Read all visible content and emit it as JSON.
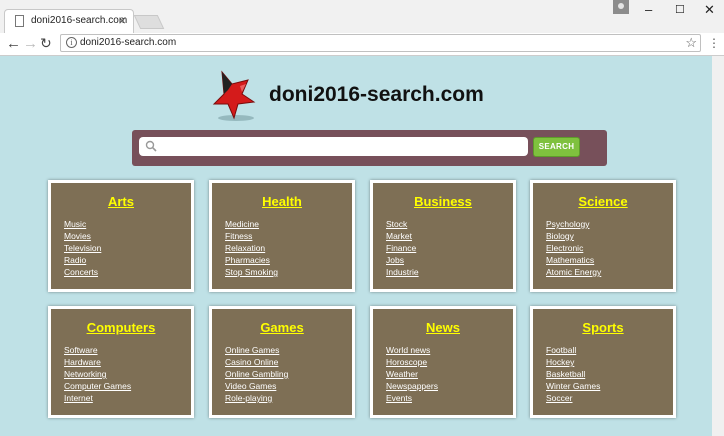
{
  "browser": {
    "tab_title": "doni2016-search.com",
    "address": "doni2016-search.com",
    "icons": [
      "document-icon",
      "close-icon",
      "user-icon",
      "minimize-icon",
      "maximize-icon",
      "close-window-icon",
      "back-icon",
      "forward-icon",
      "reload-icon",
      "info-icon",
      "bookmark-star-icon",
      "menu-icon"
    ]
  },
  "header": {
    "site_title": "doni2016-search.com",
    "logo_icon": "red-star-icon"
  },
  "search": {
    "placeholder": "",
    "button_label": "SEARCH",
    "accent": "#7fc13e",
    "bar_color": "#77505a"
  },
  "categories": [
    {
      "title": "Arts",
      "links": [
        "Music",
        "Movies",
        "Television",
        "Radio",
        "Concerts"
      ]
    },
    {
      "title": "Health",
      "links": [
        "Medicine",
        "Fitness",
        "Relaxation",
        "Pharmacies",
        "Stop Smoking"
      ]
    },
    {
      "title": "Business",
      "links": [
        "Stock",
        "Market",
        "Finance",
        "Jobs",
        "Industrie"
      ]
    },
    {
      "title": "Science",
      "links": [
        "Psychology",
        "Biology",
        "Electronic",
        "Mathematics",
        "Atomic Energy"
      ]
    },
    {
      "title": "Computers",
      "links": [
        "Software",
        "Hardware",
        "Networking",
        "Computer Games",
        "Internet"
      ]
    },
    {
      "title": "Games",
      "links": [
        "Online Games",
        "Casino Online",
        "Online Gambling",
        "Video Games",
        "Role-playing"
      ]
    },
    {
      "title": "News",
      "links": [
        "World news",
        "Horoscope",
        "Weather",
        "Newspappers",
        "Events"
      ]
    },
    {
      "title": "Sports",
      "links": [
        "Football",
        "Hockey",
        "Basketball",
        "Winter Games",
        "Soccer"
      ]
    }
  ],
  "colors": {
    "page_bg": "#bfe1e6",
    "card_bg": "#7e6f55",
    "card_title": "#ffff00"
  }
}
